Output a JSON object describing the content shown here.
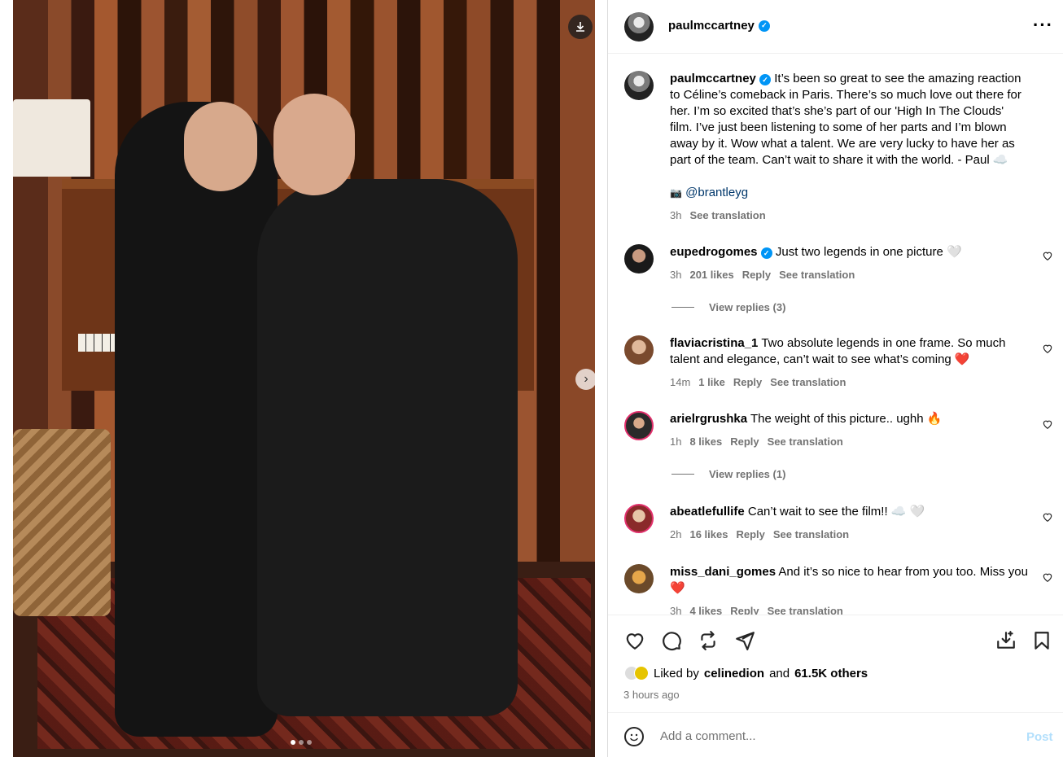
{
  "post": {
    "author": "paulmccartney",
    "caption": "It’s been so great to see the amazing reaction to Céline’s comeback in Paris. There’s so much love out there for her. I’m so excited that’s she’s part of our 'High In The Clouds' film. I’ve just been listening to some of her parts and I’m blown away by it. Wow what a talent. We are very lucky to have her as part of the team. Can’t wait to share it with the world. - Paul ☁️",
    "credit_icon": "📷",
    "credit": "@brantleyg",
    "caption_time": "3h",
    "see_translation": "See translation"
  },
  "comments": [
    {
      "user": "eupedrogomes",
      "text": "Just two legends in one picture 🤍",
      "time": "3h",
      "likes": "201 likes",
      "reply": "Reply",
      "translate": "See translation",
      "view_replies": "View replies (3)"
    },
    {
      "user": "flaviacristina_1",
      "text": "Two absolute legends in one frame. So much talent and elegance, can’t wait to see what’s coming ❤️",
      "time": "14m",
      "likes": "1 like",
      "reply": "Reply",
      "translate": "See translation"
    },
    {
      "user": "arielrgrushka",
      "text": "The weight of this picture.. ughh 🔥",
      "time": "1h",
      "likes": "8 likes",
      "reply": "Reply",
      "translate": "See translation",
      "view_replies": "View replies (1)"
    },
    {
      "user": "abeatlefullife",
      "text": "Can’t wait to see the film!! ☁️ 🤍",
      "time": "2h",
      "likes": "16 likes",
      "reply": "Reply",
      "translate": "See translation"
    },
    {
      "user": "miss_dani_gomes",
      "text": "And it’s so nice to hear from you too. Miss you ❤️",
      "time": "3h",
      "likes": "4 likes",
      "reply": "Reply",
      "translate": "See translation"
    }
  ],
  "engagement": {
    "liked_by_prefix": "Liked by",
    "liked_by_user": "celinedion",
    "and": "and",
    "others": "61.5K others",
    "time_ago": "3 hours ago"
  },
  "comment_box": {
    "placeholder": "Add a comment...",
    "post_label": "Post"
  },
  "carousel": {
    "slide_count": 3,
    "active_slide": 1
  },
  "colors": {
    "verified": "#0095f6",
    "muted": "#737373",
    "post_disabled": "#b2dffc"
  }
}
